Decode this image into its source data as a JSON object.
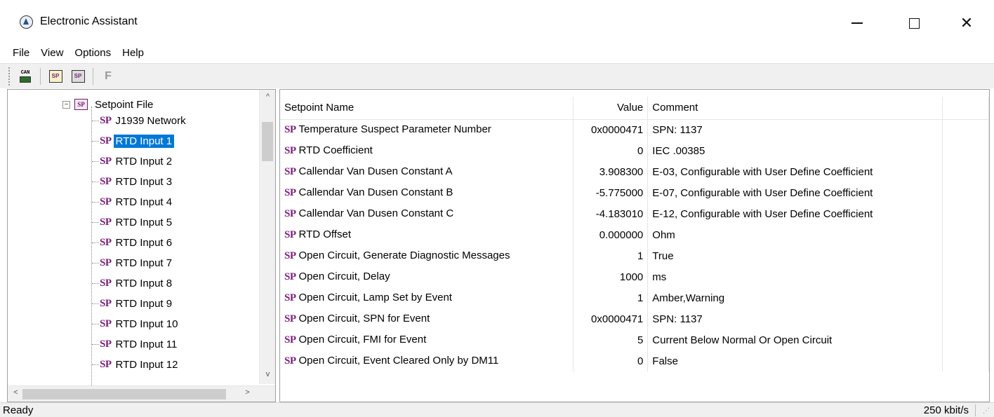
{
  "window": {
    "title": "Electronic Assistant",
    "min_glyph": "—",
    "max_glyph": "☐",
    "close_glyph": "✕"
  },
  "menu": [
    "File",
    "View",
    "Options",
    "Help"
  ],
  "toolbar": {
    "can_label": "CAN",
    "sp_label": "SP",
    "f_label": "F",
    "icons": [
      "can-connect-icon",
      "open-setpoint-icon",
      "save-setpoint-icon",
      "flash-icon"
    ]
  },
  "tree": {
    "root": {
      "label": "Setpoint File",
      "expander": "−",
      "icon_text": "SP"
    },
    "sp_glyph": "SP",
    "items": [
      "J1939 Network",
      "RTD Input 1",
      "RTD Input 2",
      "RTD Input 3",
      "RTD Input 4",
      "RTD Input 5",
      "RTD Input 6",
      "RTD Input 7",
      "RTD Input 8",
      "RTD Input 9",
      "RTD Input 10",
      "RTD Input 11",
      "RTD Input 12"
    ],
    "selected": "RTD Input 1",
    "scroll_up": "^",
    "scroll_down": "v",
    "scroll_left": "<",
    "scroll_right": ">"
  },
  "table": {
    "headers": {
      "name": "Setpoint Name",
      "value": "Value",
      "comment": "Comment"
    },
    "sp_glyph": "SP",
    "rows": [
      {
        "name": "Temperature Suspect Parameter Number",
        "value": "0x0000471",
        "comment": "SPN: 1137"
      },
      {
        "name": "RTD Coefficient",
        "value": "0",
        "comment": "IEC .00385"
      },
      {
        "name": "Callendar Van Dusen Constant A",
        "value": "3.908300",
        "comment": "E-03, Configurable with User Define Coefficient"
      },
      {
        "name": "Callendar Van Dusen Constant B",
        "value": "-5.775000",
        "comment": "E-07, Configurable with User Define Coefficient"
      },
      {
        "name": "Callendar Van Dusen Constant C",
        "value": "-4.183010",
        "comment": "E-12, Configurable with User Define Coefficient"
      },
      {
        "name": "RTD Offset",
        "value": "0.000000",
        "comment": "Ohm"
      },
      {
        "name": "Open Circuit, Generate Diagnostic Messages",
        "value": "1",
        "comment": "True"
      },
      {
        "name": "Open Circuit, Delay",
        "value": "1000",
        "comment": "ms"
      },
      {
        "name": "Open Circuit, Lamp Set by Event",
        "value": "1",
        "comment": "Amber,Warning"
      },
      {
        "name": "Open Circuit, SPN for Event",
        "value": "0x0000471",
        "comment": "SPN: 1137"
      },
      {
        "name": "Open Circuit, FMI for Event",
        "value": "5",
        "comment": "Current Below Normal Or Open Circuit"
      },
      {
        "name": "Open Circuit, Event Cleared Only by DM11",
        "value": "0",
        "comment": "False"
      }
    ]
  },
  "status": {
    "text": "Ready",
    "baud": "250 kbit/s"
  },
  "colors": {
    "selection": "#0078d7",
    "sp_purple": "#7a1f7a"
  }
}
